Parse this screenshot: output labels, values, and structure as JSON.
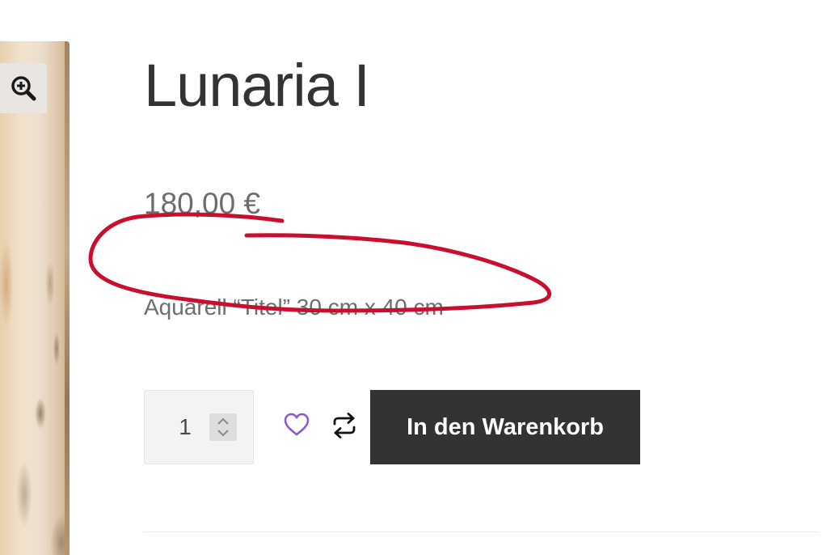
{
  "product": {
    "title": "Lunaria I",
    "price": "180,00 €",
    "description": "Aquarell “Titel” 30 cm x 40 cm"
  },
  "cart": {
    "quantity": "1",
    "add_to_cart_label": "In den Warenkorb"
  },
  "icons": {
    "zoom": "zoom-in-icon",
    "wishlist": "heart-icon",
    "compare": "compare-arrows-icon",
    "spinner": "chevron-up-down-icon"
  },
  "colors": {
    "title": "#333333",
    "price": "#6d6d6d",
    "button_bg": "#333333",
    "button_text": "#ffffff",
    "wishlist_accent": "#8a5cc9",
    "annotation": "#c8102e"
  }
}
